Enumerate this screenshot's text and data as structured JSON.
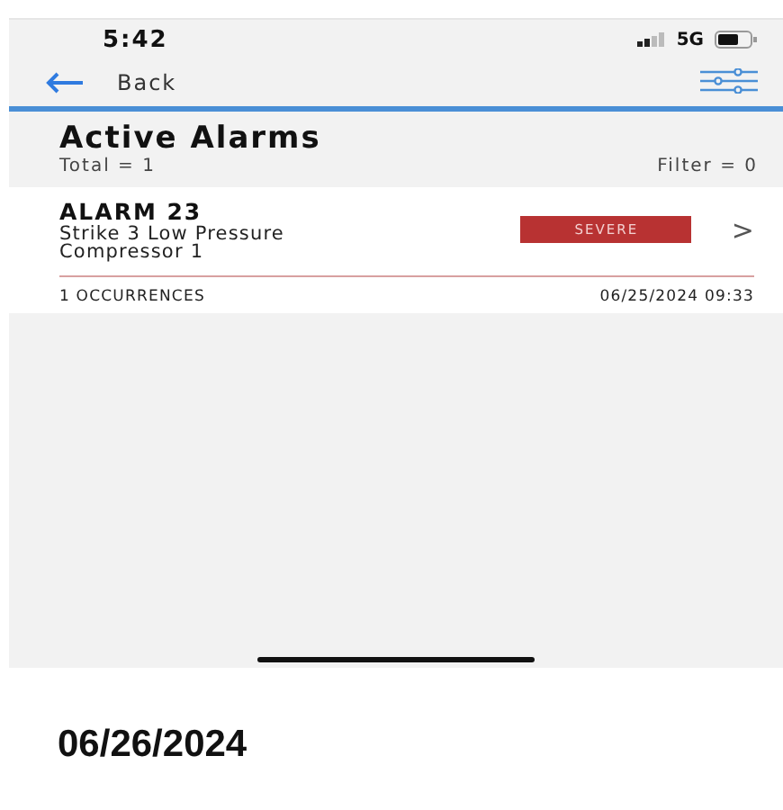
{
  "status_bar": {
    "time": "5:42",
    "network": "5G"
  },
  "nav": {
    "back_label": "Back"
  },
  "header": {
    "title": "Active Alarms",
    "total": "Total = 1",
    "filter": "Filter = 0"
  },
  "alarms": [
    {
      "name": "ALARM 23",
      "description": "Strike 3 Low Pressure Compressor 1",
      "severity": "SEVERE",
      "color": "#b83232",
      "chevron": ">",
      "occurrences": "1 OCCURRENCES",
      "timestamp": "06/25/2024 09:33"
    }
  ],
  "caption": "06/26/2024"
}
